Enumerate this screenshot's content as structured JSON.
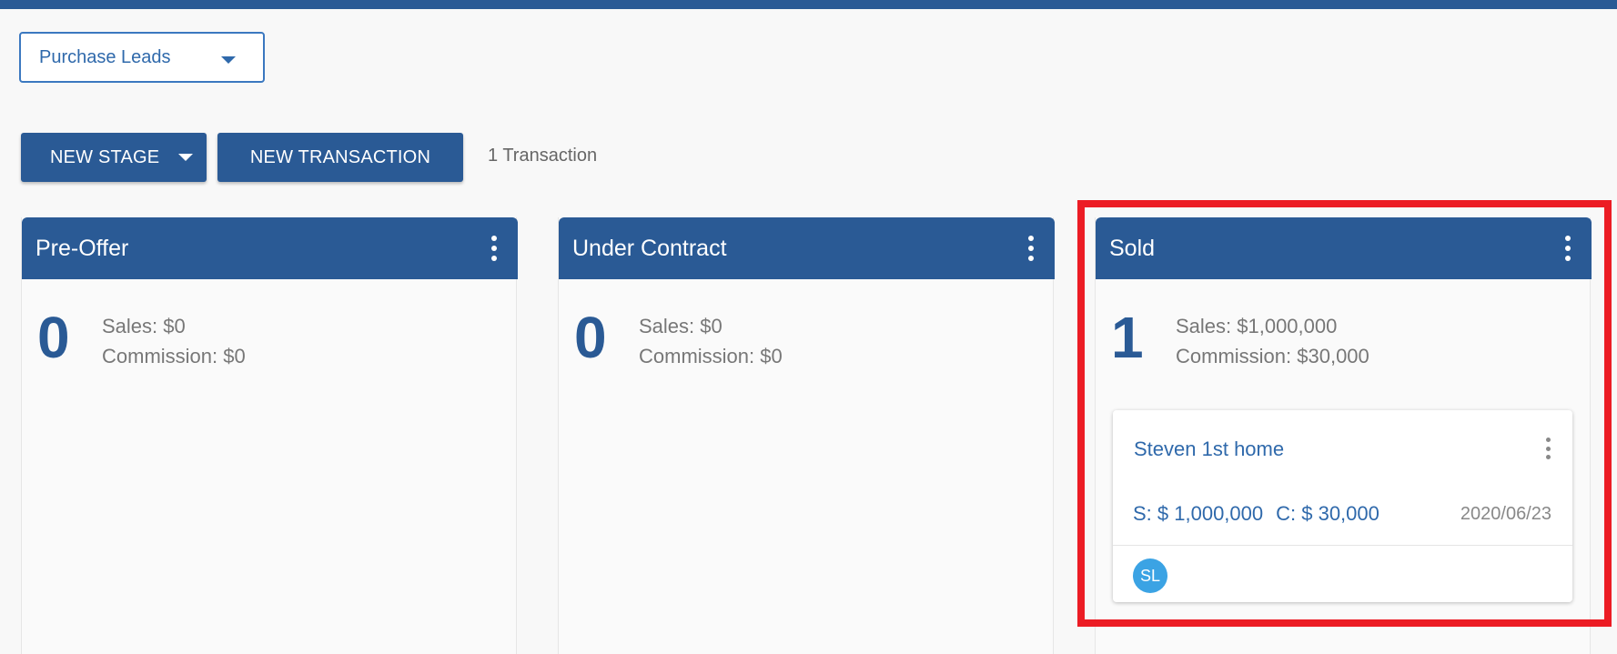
{
  "colors": {
    "primary": "#2a5a95",
    "accent_link": "#2f69ab",
    "avatar": "#3ba3e4",
    "highlight": "#ec1c24"
  },
  "pipeline_select": {
    "value": "Purchase Leads",
    "icon": "chevron-down-icon"
  },
  "toolbar": {
    "new_stage_label": "NEW STAGE",
    "new_transaction_label": "NEW TRANSACTION",
    "transaction_count": "1 Transaction"
  },
  "stages": [
    {
      "title": "Pre-Offer",
      "count": "0",
      "sales": "Sales: $0",
      "commission": "Commission: $0"
    },
    {
      "title": "Under Contract",
      "count": "0",
      "sales": "Sales: $0",
      "commission": "Commission: $0"
    },
    {
      "title": "Sold",
      "count": "1",
      "sales": "Sales: $1,000,000",
      "commission": "Commission: $30,000",
      "cards": [
        {
          "title": "Steven 1st home",
          "sales": "S: $ 1,000,000",
          "commission": "C: $ 30,000",
          "date": "2020/06/23",
          "avatar_initials": "SL"
        }
      ]
    }
  ]
}
